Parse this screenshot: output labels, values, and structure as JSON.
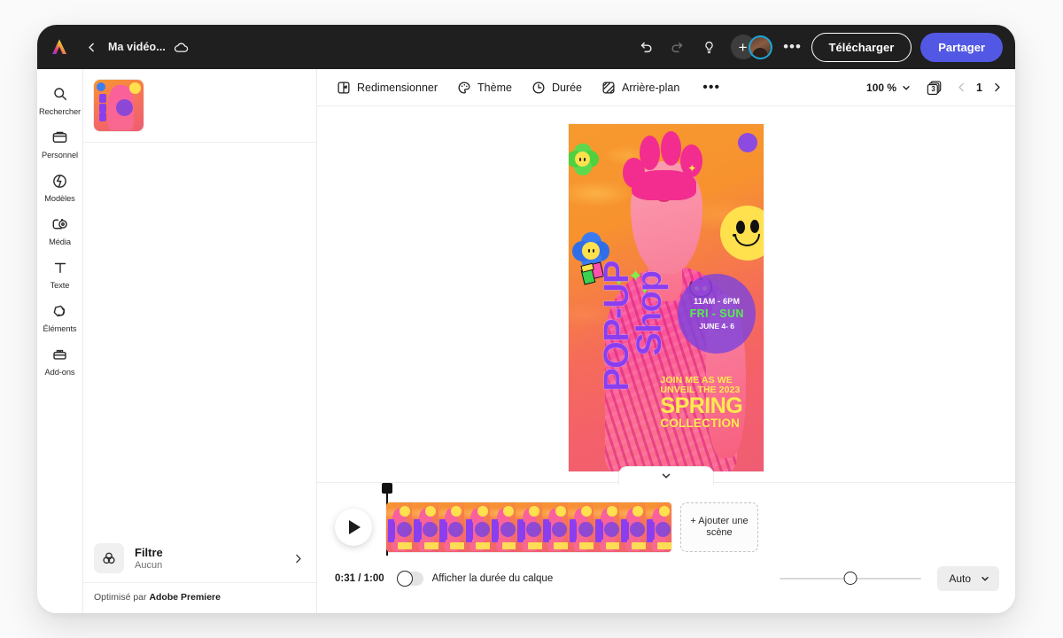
{
  "topbar": {
    "logo_icon": "adobe-express-logo",
    "back_icon": "chevron-left-icon",
    "doc_title": "Ma vidéo...",
    "cloud_icon": "cloud-saved-icon",
    "undo_icon": "undo-icon",
    "redo_icon": "redo-icon",
    "hint_icon": "lightbulb-icon",
    "add_collaborator_icon": "plus-icon",
    "avatar_icon": "user-avatar",
    "more_icon": "ellipsis-icon",
    "download_label": "Télécharger",
    "share_label": "Partager",
    "share_color": "#5258e4"
  },
  "rail": {
    "items": [
      {
        "label": "Rechercher",
        "icon": "search-icon"
      },
      {
        "label": "Personnel",
        "icon": "folder-icon"
      },
      {
        "label": "Modèles",
        "icon": "templates-icon"
      },
      {
        "label": "Média",
        "icon": "media-icon"
      },
      {
        "label": "Texte",
        "icon": "text-icon"
      },
      {
        "label": "Éléments",
        "icon": "elements-icon"
      },
      {
        "label": "Add-ons",
        "icon": "addons-icon"
      }
    ]
  },
  "panel": {
    "scene_thumb_icon": "scene-thumbnail",
    "filter": {
      "icon": "filter-icon",
      "title": "Filtre",
      "value": "Aucun",
      "chevron_icon": "chevron-right-icon"
    },
    "footer_prefix": "Optimisé par ",
    "footer_brand": "Adobe Premiere"
  },
  "context_bar": {
    "items": [
      {
        "label": "Redimensionner",
        "icon": "resize-icon"
      },
      {
        "label": "Thème",
        "icon": "palette-icon"
      },
      {
        "label": "Durée",
        "icon": "clock-icon"
      },
      {
        "label": "Arrière-plan",
        "icon": "background-icon"
      }
    ],
    "more_icon": "ellipsis-icon",
    "zoom_value": "100 %",
    "zoom_chevron_icon": "chevron-down-icon",
    "pages_icon": "pages-icon",
    "pages_count": "3",
    "prev_icon": "chevron-left-icon",
    "page_number": "1",
    "next_icon": "chevron-right-icon"
  },
  "poster": {
    "headline_line1": "POP-UP",
    "headline_line2": "Shop",
    "badge_time": "11AM - 6PM",
    "badge_days": "FRI - SUN",
    "badge_date": "JUNE 4- 6",
    "promo_line1": "JOIN ME AS WE",
    "promo_line2": "UNVEIL THE 2023",
    "promo_line3": "SPRING",
    "promo_line4": "COLLECTION",
    "headline_color": "#8b3ef0",
    "badge_days_color": "#55f04a",
    "promo_color": "#ffe94f"
  },
  "timeline": {
    "collapse_icon": "chevron-down-icon",
    "play_icon": "play-icon",
    "playhead_icon": "playhead-marker",
    "add_scene_label": "+ Ajouter une scène",
    "time_readout": "0:31 / 1:00",
    "layer_toggle_icon": "toggle-off",
    "layer_toggle_label": "Afficher la durée du calque",
    "zoom_slider_icon": "zoom-slider",
    "auto_label": "Auto",
    "auto_chevron_icon": "chevron-down-icon"
  }
}
